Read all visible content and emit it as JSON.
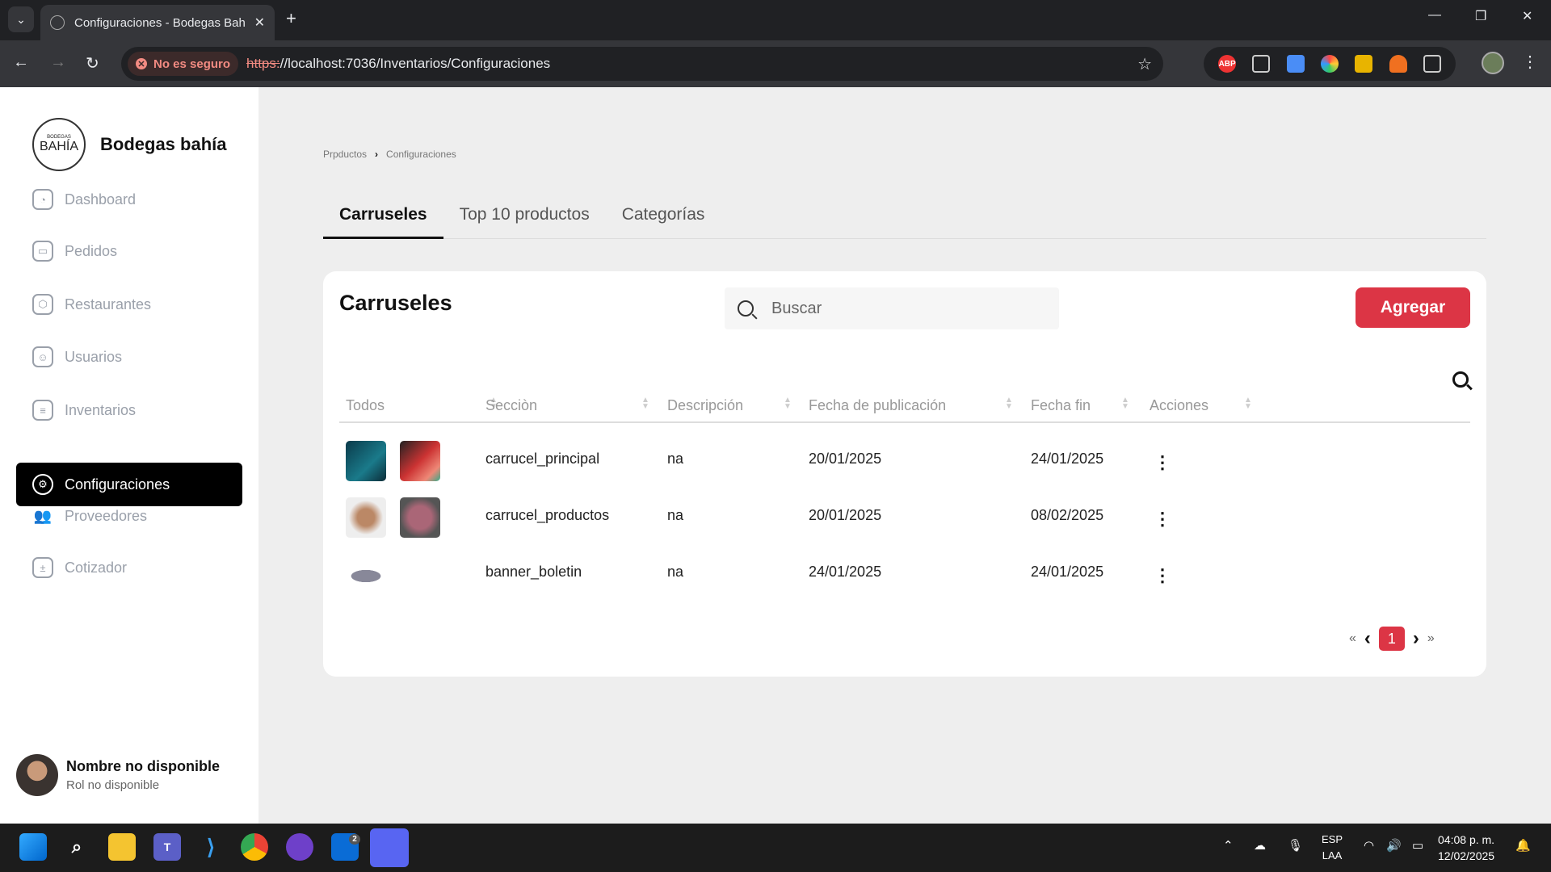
{
  "browser": {
    "tab_title": "Configuraciones - Bodegas Bah",
    "security_label": "No es seguro",
    "url_proto": "https:",
    "url_rest": "//localhost:7036/Inventarios/Configuraciones"
  },
  "sidebar": {
    "logo_top": "BODEGAS",
    "logo_main": "BAHÍA",
    "brand": "Bodegas bahía",
    "items": [
      {
        "label": "Dashboard",
        "icon": "dashboard-icon"
      },
      {
        "label": "Pedidos",
        "icon": "ticket-icon"
      },
      {
        "label": "Restaurantes",
        "icon": "box-icon"
      },
      {
        "label": "Usuarios",
        "icon": "user-icon"
      },
      {
        "label": "Inventarios",
        "icon": "database-icon"
      },
      {
        "label": "Configuraciones",
        "icon": "gear-icon"
      },
      {
        "label": "Proveedores",
        "icon": "users-icon"
      },
      {
        "label": "Cotizador",
        "icon": "calculator-icon"
      }
    ],
    "active": "Configuraciones",
    "user_name": "Nombre no disponible",
    "user_role": "Rol no disponible"
  },
  "breadcrumb": {
    "parent": "Prpductos",
    "current": "Configuraciones"
  },
  "tabs": [
    {
      "label": "Carruseles",
      "active": true
    },
    {
      "label": "Top 10 productos",
      "active": false
    },
    {
      "label": "Categorías",
      "active": false
    }
  ],
  "card": {
    "title": "Carruseles",
    "search_placeholder": "Buscar",
    "add_label": "Agregar"
  },
  "table": {
    "headers": [
      "Todos",
      "Secciòn",
      "Descripción",
      "Fecha de publicación",
      "Fecha fin",
      "Acciones"
    ],
    "rows": [
      {
        "seccion": "carrucel_principal",
        "descripcion": "na",
        "fecha_pub": "20/01/2025",
        "fecha_fin": "24/01/2025"
      },
      {
        "seccion": "carrucel_productos",
        "descripcion": "na",
        "fecha_pub": "20/01/2025",
        "fecha_fin": "08/02/2025"
      },
      {
        "seccion": "banner_boletin",
        "descripcion": "na",
        "fecha_pub": "24/01/2025",
        "fecha_fin": "24/01/2025"
      }
    ]
  },
  "pagination": {
    "first": "«",
    "prev": "‹",
    "current": "1",
    "next": "›",
    "last": "»"
  },
  "taskbar": {
    "lang_top": "ESP",
    "lang_bottom": "LAA",
    "time": "04:08 p. m.",
    "date": "12/02/2025",
    "store_badge": "2"
  },
  "colors": {
    "accent": "#dc3545",
    "active_nav": "#000000"
  }
}
